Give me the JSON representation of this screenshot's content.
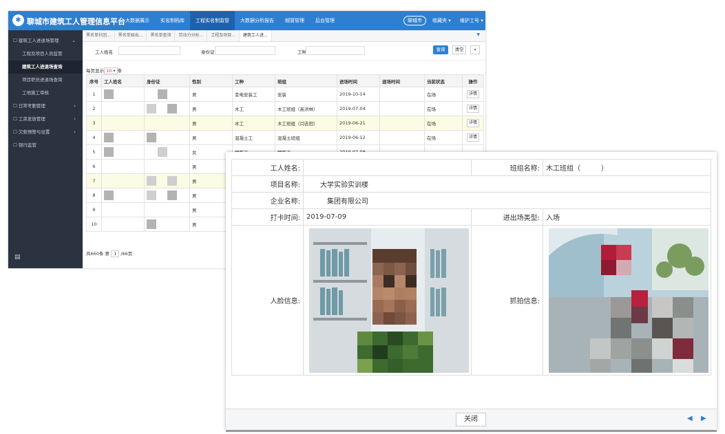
{
  "app": {
    "title": "聊城市建筑工人管理信息平台",
    "nav": [
      "大数据展示",
      "实名制档库",
      "工程实名制监管",
      "大数据分析报告",
      "越冒管理",
      "后台管理"
    ],
    "nav_active": 2,
    "city": "聊城市",
    "favorites": "收藏夹 ▾",
    "user": "维护工号 ▾"
  },
  "sidebar": {
    "items": [
      {
        "label": "建筑工人进退场管理",
        "arrow": "⌄",
        "type": "group"
      },
      {
        "label": "工程及项目人员监管",
        "arrow": "",
        "type": "sub"
      },
      {
        "label": "建筑工人进退场查询",
        "arrow": "",
        "type": "sub-active"
      },
      {
        "label": "项目职员进退场查询",
        "arrow": "",
        "type": "sub"
      },
      {
        "label": "工地施工审核",
        "arrow": "",
        "type": "sub"
      },
      {
        "label": "日常考勤管理",
        "arrow": "›",
        "type": "group"
      },
      {
        "label": "工资发放管理",
        "arrow": "›",
        "type": "group"
      },
      {
        "label": "欠薪预警与设置",
        "arrow": "›",
        "type": "group"
      },
      {
        "label": "银行监管",
        "arrow": "",
        "type": "group"
      }
    ],
    "footer_icon": "menu-icon"
  },
  "tabs": [
    "黑名单社团...",
    "黑名单娱出...",
    "黑名单查询",
    "劳动力分析...",
    "工程及项目...",
    "建筑工人进..."
  ],
  "filters": {
    "name_label": "工人姓名",
    "id_label": "身份证",
    "type_label": "工种",
    "query": "查询",
    "clear": "清空",
    "more": "▾"
  },
  "page_size": {
    "prefix": "每页显示",
    "value": "10 ▾",
    "suffix": "条"
  },
  "table": {
    "headers": [
      "序号",
      "工人姓名",
      "身份证",
      "性别",
      "工种",
      "班组",
      "进场时间",
      "退场时间",
      "当前状态",
      "操作"
    ],
    "rows": [
      {
        "no": "1",
        "sex": "男",
        "type": "变电安装工",
        "team": "安装",
        "enter": "2019-10-14",
        "exit": "",
        "status": "在场",
        "op": "详情"
      },
      {
        "no": "2",
        "sex": "男",
        "type": "木工",
        "team": "木工班组（高洪林）",
        "enter": "2019-07-04",
        "exit": "",
        "status": "在场",
        "op": "详情"
      },
      {
        "no": "3",
        "sex": "男",
        "type": "木工",
        "team": "木工班组（闫吉田）",
        "enter": "2019-06-21",
        "exit": "",
        "status": "在场",
        "op": "详情"
      },
      {
        "no": "4",
        "sex": "男",
        "type": "混凝土工",
        "team": "混凝土班组",
        "enter": "2019-06-12",
        "exit": "",
        "status": "在场",
        "op": "详情"
      },
      {
        "no": "5",
        "sex": "女",
        "type": "钢筋工",
        "team": "钢筋工",
        "enter": "2019-07-08",
        "exit": "",
        "status": "",
        "op": ""
      },
      {
        "no": "6",
        "sex": "男",
        "type": "",
        "team": "",
        "enter": "",
        "exit": "",
        "status": "",
        "op": ""
      },
      {
        "no": "7",
        "sex": "男",
        "type": "",
        "team": "",
        "enter": "",
        "exit": "",
        "status": "",
        "op": ""
      },
      {
        "no": "8",
        "sex": "男",
        "type": "",
        "team": "",
        "enter": "",
        "exit": "",
        "status": "",
        "op": ""
      },
      {
        "no": "9",
        "sex": "男",
        "type": "",
        "team": "",
        "enter": "",
        "exit": "",
        "status": "",
        "op": ""
      },
      {
        "no": "10",
        "sex": "男",
        "type": "",
        "team": "",
        "enter": "",
        "exit": "",
        "status": "",
        "op": ""
      }
    ],
    "highlight_rows": [
      2,
      6
    ]
  },
  "pagination": {
    "prefix": "共660条 第",
    "page": "1",
    "suffix": "/66页"
  },
  "modal": {
    "name_label": "工人姓名:",
    "name_value": "",
    "team_label": "班组名称:",
    "team_value": "木工班组（　　　）",
    "project_label": "项目名称:",
    "project_value": "　　大学实验实训楼",
    "company_label": "企业名称:",
    "company_value": "　　　集团有限公司",
    "clock_label": "打卡时间:",
    "clock_value": "2019-07-09",
    "inout_label": "进出场类型:",
    "inout_value": "入场",
    "face_label": "人脸信息:",
    "capture_label": "抓拍信息:",
    "close": "关闭",
    "prev": "◀",
    "next": "▶"
  }
}
